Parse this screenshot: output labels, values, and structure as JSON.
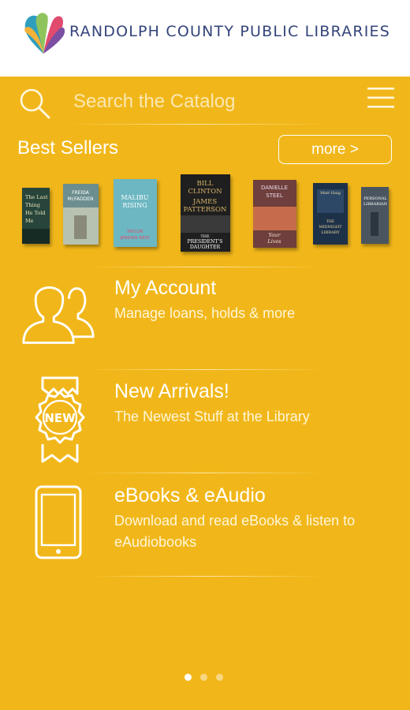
{
  "header": {
    "logo_text": "RANDOLPH COUNTY PUBLIC LIBRARIES"
  },
  "search": {
    "placeholder": "Search the Catalog"
  },
  "best_sellers": {
    "title": "Best Sellers",
    "more_label": "more >",
    "books": [
      {
        "lines": [
          "The Last",
          "Thing",
          "He Told",
          "Me"
        ],
        "bg": "#27453b"
      },
      {
        "lines": [
          "FREIDA",
          "McFADDEN"
        ],
        "bg": "#6c8e8f"
      },
      {
        "lines": [
          "MALIBU",
          "RISING",
          "TAYLOR",
          "JENKINS REID"
        ],
        "bg": "#6cb7c2"
      },
      {
        "lines": [
          "BILL",
          "CLINTON",
          "JAMES",
          "PATTERSON",
          "THE",
          "PRESIDENT'S",
          "DAUGHTER"
        ],
        "bg": "#1f1f1f"
      },
      {
        "lines": [
          "DANIELLE",
          "STEEL",
          "Your",
          "Lives"
        ],
        "bg": "#6e3f3c"
      },
      {
        "lines": [
          "Matt Haig",
          "THE",
          "MIDNIGHT",
          "LIBRARY"
        ],
        "bg": "#1d3148"
      },
      {
        "lines": [
          "PERSONAL",
          "LIBRARIAN"
        ],
        "bg": "#4a5560"
      }
    ]
  },
  "features": [
    {
      "title": "My Account",
      "desc": "Manage loans, holds & more",
      "icon": "users-icon"
    },
    {
      "title": "New Arrivals!",
      "desc": "The Newest Stuff at the Library",
      "icon": "new-badge-icon",
      "badge_text": "NEW"
    },
    {
      "title": "eBooks & eAudio",
      "desc": "Download and read eBooks & listen to eAudiobooks",
      "icon": "tablet-icon"
    }
  ],
  "pagination": {
    "pages": 3,
    "active": 1
  },
  "colors": {
    "background": "#f1b71a",
    "header": "#ffffff",
    "logo_text": "#34447a"
  }
}
